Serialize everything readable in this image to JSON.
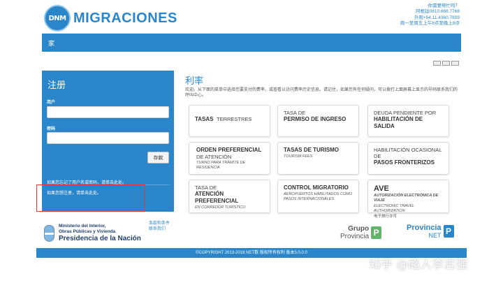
{
  "header": {
    "logo_badge": "DNM",
    "logo_text": "MIGRACIONES",
    "contact": [
      "你需要帮忙吗？",
      "阿根廷0810.666.7768",
      "外观+54.11.4360.7809",
      "周一至周五上午8点至晚上8点"
    ]
  },
  "nav": {
    "home": "家"
  },
  "register": {
    "title": "注册",
    "user_label": "用户",
    "password_label": "密码",
    "save_button": "存款",
    "forgot_link": "如果您忘记了用户名或密码，请单击此处。",
    "signup_link": "如果您想注册，请单击此处。"
  },
  "ministry": {
    "line1": "Ministerio del Interior,",
    "line2": "Obras Públicas y Vivienda",
    "line3": "Presidencia de la Nación"
  },
  "terms": {
    "conditions": "条款和条件",
    "contact": "联系我们"
  },
  "main": {
    "title": "利率",
    "intro": "欢迎。从下面的菜单中选择您要支付的费率，或查看以访问费率历史信息。请记住，如果您有任何疑问，可以拨打上面屏幕上显示的号码联系我们的呼叫中心。",
    "tiles": [
      {
        "l1": "TASAS",
        "l1b": "TERRESTRES"
      },
      {
        "l1": "TASA DE",
        "l2": "PERMISO DE INGRESO"
      },
      {
        "l1": "DEUDA PENDIENTE POR",
        "l2": "HABILITACIÓN DE SALIDA"
      },
      {
        "l1": "ORDEN PREFERENCIAL",
        "l2": "DE ATENCIÓN",
        "l3": "TURNO PARA TRÁMITE DE RESIDENCIA"
      },
      {
        "l1": "TASAS DE TURISMO",
        "l3": "TOURISM FEES"
      },
      {
        "l1": "HABILITACIÓN OCASIONAL DE",
        "l2": "PASOS FRONTERIZOS"
      },
      {
        "l1": "TASA DE",
        "l2": "ATENCIÓN PREFERENCIAL",
        "l3": "EN CORREDOR TURÍSTICO"
      },
      {
        "l1": "CONTROL MIGRATORIO",
        "l3": "AEROPUERTOS HABILITADOS COMO PASOS INTERNACIONALES"
      },
      {
        "l1": "AVE",
        "l3a": "AUTORIZACIÓN ELECTRÓNICA DE VIAJE",
        "l3b": "ELECTRONIC TRAVEL AUTHORIZATION",
        "l4": "电子旅行许可"
      }
    ]
  },
  "logos": {
    "grupo1": "Grupo",
    "grupo2": "Provincia",
    "badge": "P",
    "prov1": "Provincia",
    "prov2": "NET"
  },
  "footer": {
    "text": "©COPYRIGHT 2013-2018 NET数 版权所有权利 版本5.0.0.0"
  },
  "watermark": "知乎 @路人李志强"
}
